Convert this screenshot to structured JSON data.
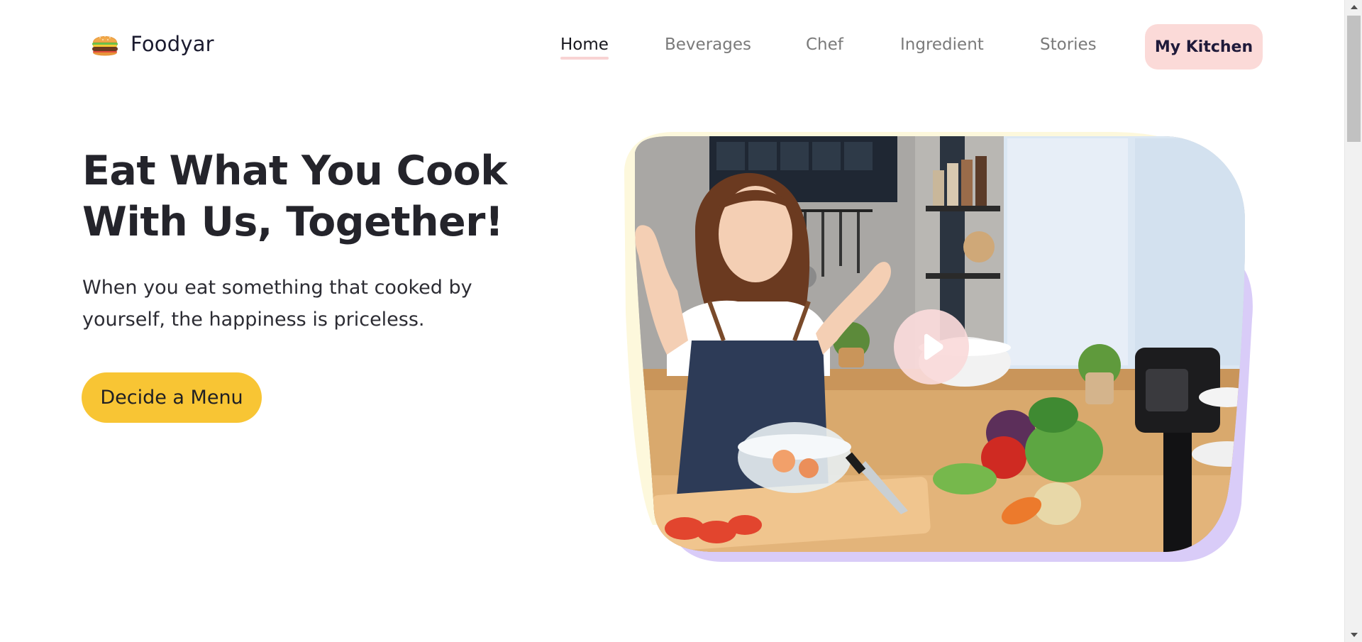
{
  "brand": {
    "name": "Foodyar",
    "icon": "burger-icon"
  },
  "nav": {
    "items": [
      {
        "label": "Home",
        "active": true
      },
      {
        "label": "Beverages",
        "active": false
      },
      {
        "label": "Chef",
        "active": false
      },
      {
        "label": "Ingredient",
        "active": false
      },
      {
        "label": "Stories",
        "active": false
      }
    ],
    "cta_label": "My Kitchen"
  },
  "hero": {
    "title_line1": "Eat What You Cook",
    "title_line2": "With Us, Together!",
    "subtitle_line1": "When you eat something that cooked by",
    "subtitle_line2": "yourself, the happiness is priceless.",
    "button_label": "Decide a Menu",
    "media_icon": "play-icon"
  },
  "colors": {
    "accent_yellow": "#f8c534",
    "accent_pink": "#fbdad8",
    "accent_purple": "#d9ccf8",
    "accent_cream": "#fdf8dc"
  }
}
